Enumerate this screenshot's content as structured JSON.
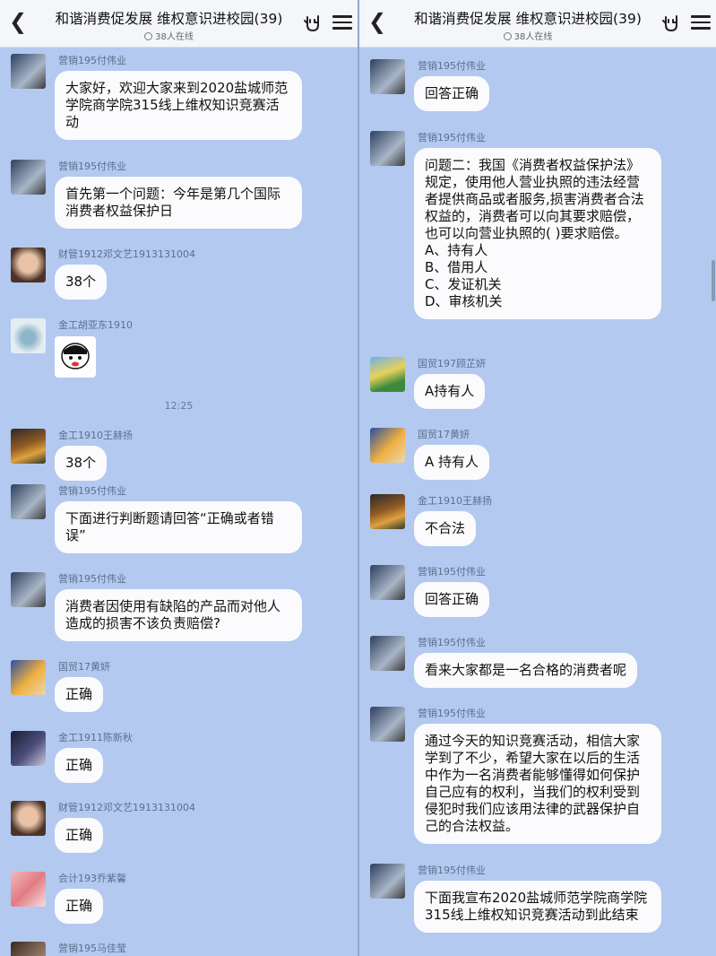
{
  "header": {
    "title": "和谐消费促发展  维权意识进校园(39)",
    "online": "38人在线"
  },
  "left": {
    "messages": [
      {
        "name": "营销195付伟业",
        "text": "大家好，欢迎大家来到2020盐城师范学院商学院315线上维权知识竞赛活动"
      },
      {
        "name": "营销195付伟业",
        "text": "首先第一个问题：今年是第几个国际消费者权益保护日"
      },
      {
        "name": "财管1912邓文艺1913131004",
        "text": "38个"
      },
      {
        "name": "金工胡亚东1910"
      },
      {
        "name": "金工1910王赫扬",
        "text": "38个"
      },
      {
        "name": "营销195付伟业",
        "text": "下面进行判断题请回答“正确或者错误”"
      },
      {
        "name": "营销195付伟业",
        "text": "消费者因使用有缺陷的产品而对他人造成的损害不该负责赔偿?"
      },
      {
        "name": "国贸17黄妍",
        "text": "正确"
      },
      {
        "name": "金工1911陈新秋",
        "text": "正确"
      },
      {
        "name": "财管1912邓文艺1913131004",
        "text": "正确"
      },
      {
        "name": "会计193乔紫馨",
        "text": "正确"
      },
      {
        "name": "营销195马佳莹"
      }
    ],
    "time": "12:25"
  },
  "right": {
    "messages": [
      {
        "name": "营销195付伟业",
        "text": "回答正确"
      },
      {
        "name": "营销195付伟业",
        "text": "问题二：我国《消费者权益保护法》规定，使用他人营业执照的违法经营者提供商品或者服务,损害消费者合法权益的，消费者可以向其要求赔偿，也可以向营业执照的( )要求赔偿。\nA、持有人\nB、借用人\nC、发证机关\nD、审核机关"
      },
      {
        "name": "国贸197顾芷妍",
        "text": "A持有人"
      },
      {
        "name": "国贸17黄妍",
        "text": "A 持有人"
      },
      {
        "name": "金工1910王赫扬",
        "text": "不合法"
      },
      {
        "name": "营销195付伟业",
        "text": "回答正确"
      },
      {
        "name": "营销195付伟业",
        "text": "看来大家都是一名合格的消费者呢"
      },
      {
        "name": "营销195付伟业",
        "text": "通过今天的知识竞赛活动，相信大家学到了不少，希望大家在以后的生活中作为一名消费者能够懂得如何保护自己应有的权利，当我们的权利受到侵犯时我们应该用法律的武器保护自己的合法权益。"
      },
      {
        "name": "营销195付伟业",
        "text": "下面我宣布2020盐城师范学院商学院315线上维权知识竞赛活动到此结束"
      }
    ]
  },
  "colors": {
    "chat_bg": "#b3c9f0",
    "bubble": "#fbfbfd",
    "name_text": "#5e6f8c"
  },
  "icons": [
    "back-arrow-icon",
    "rock-hand-icon",
    "menu-icon",
    "online-icon"
  ]
}
